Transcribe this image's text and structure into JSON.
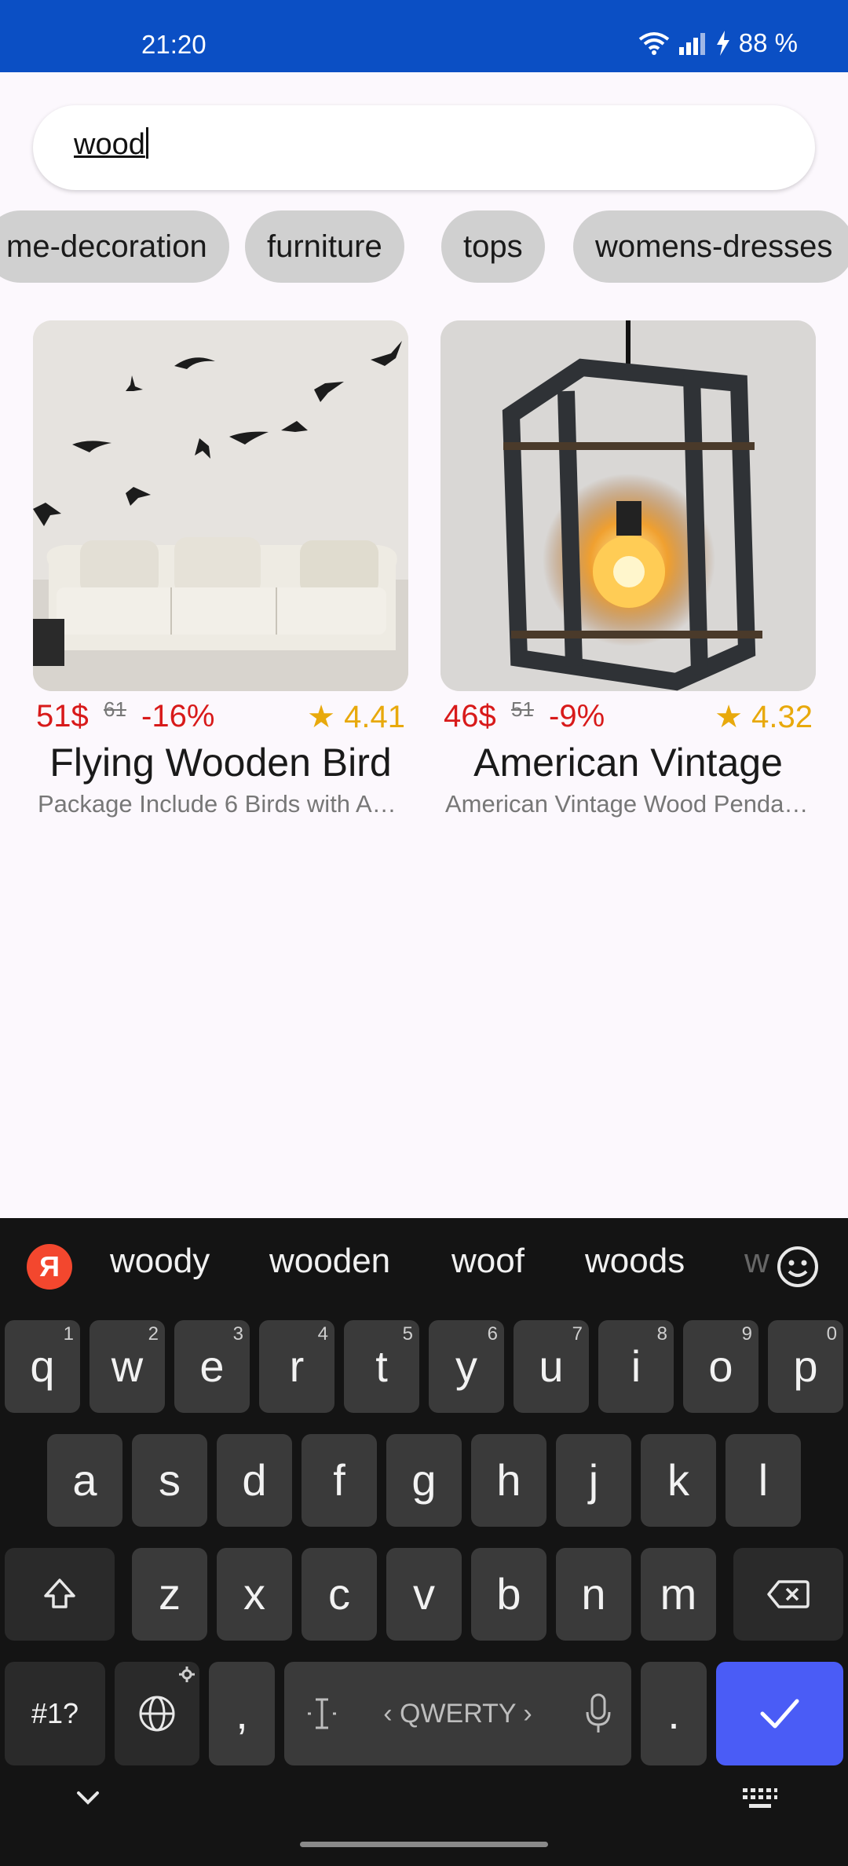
{
  "status_bar": {
    "time": "21:20",
    "battery": "88 %"
  },
  "search": {
    "value": "wood"
  },
  "chips": [
    "me-decoration",
    "furniture",
    "tops",
    "womens-dresses"
  ],
  "products": [
    {
      "price": "51$",
      "old_price": "61",
      "discount": "-16%",
      "rating": "★ 4.41",
      "title": "Flying Wooden Bird",
      "description": "Package Include 6 Birds with Adhesive Tape"
    },
    {
      "price": "46$",
      "old_price": "51",
      "discount": "-9%",
      "rating": "★ 4.32",
      "title": "American Vintage",
      "description": "American Vintage Wood Pendant Light"
    }
  ],
  "keyboard": {
    "suggestions": [
      "woody",
      "wooden",
      "woof",
      "woods",
      "w"
    ],
    "logo": "Я",
    "row1": [
      {
        "k": "q",
        "n": "1"
      },
      {
        "k": "w",
        "n": "2"
      },
      {
        "k": "e",
        "n": "3"
      },
      {
        "k": "r",
        "n": "4"
      },
      {
        "k": "t",
        "n": "5"
      },
      {
        "k": "y",
        "n": "6"
      },
      {
        "k": "u",
        "n": "7"
      },
      {
        "k": "i",
        "n": "8"
      },
      {
        "k": "o",
        "n": "9"
      },
      {
        "k": "p",
        "n": "0"
      }
    ],
    "row2": [
      "a",
      "s",
      "d",
      "f",
      "g",
      "h",
      "j",
      "k",
      "l"
    ],
    "row3": [
      "z",
      "x",
      "c",
      "v",
      "b",
      "n",
      "m"
    ],
    "symbols_label": "#1?",
    "comma": ",",
    "period": ".",
    "space_label": "‹ QWERTY ›",
    "accent_color": "#4a5cf6"
  }
}
